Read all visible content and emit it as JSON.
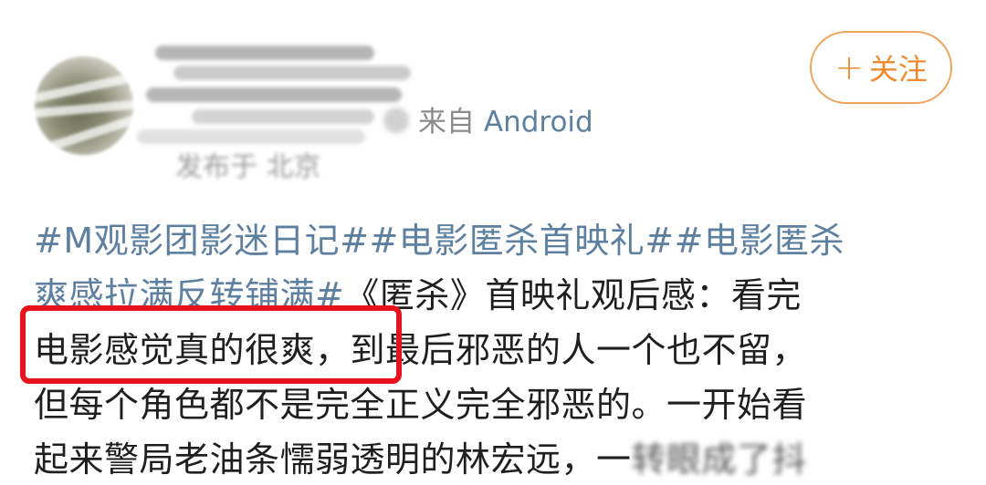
{
  "header": {
    "source_prefix": "来自",
    "source_platform": "Android",
    "location": "发布于 北京",
    "follow_plus": "+",
    "follow_label": "关注"
  },
  "post": {
    "line1": {
      "tag1": "#M观影团影迷日记#",
      "tag2": "#电影匿杀首映礼#",
      "tag3_start": "#电影匿杀"
    },
    "line2": {
      "tag3_end": "爽感拉满反转铺满#",
      "text": "《匿杀》首映礼观后感：看完"
    },
    "line3": {
      "highlighted": "电影感觉真的很爽，",
      "text": "到最后邪恶的人一个也不留，"
    },
    "line4": "但每个角色都不是完全正义完全邪恶的。一开始看",
    "line5": {
      "text": "起来警局老油条懦弱透明的林宏远，一",
      "blurred": "转眼成了抖"
    }
  },
  "colors": {
    "link": "#5d7fa0",
    "follow": "#ee8b2f",
    "highlight": "#e8121d",
    "text": "#1f1f1f"
  },
  "icons": {
    "avatar": "avatar-image",
    "follow_plus": "plus-icon"
  }
}
